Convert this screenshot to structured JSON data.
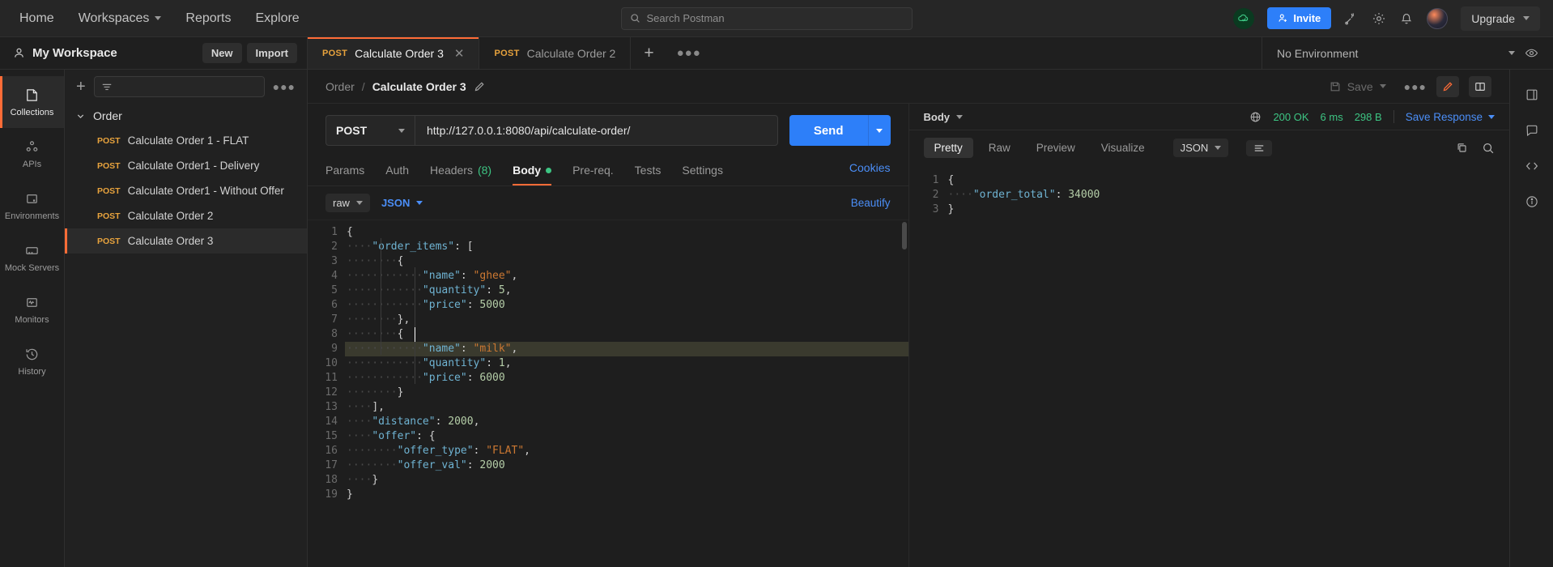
{
  "topbar": {
    "nav": [
      {
        "label": "Home",
        "icon": "none"
      },
      {
        "label": "Workspaces",
        "icon": "chevron-down-icon"
      },
      {
        "label": "Reports",
        "icon": "none"
      },
      {
        "label": "Explore",
        "icon": "none"
      }
    ],
    "search_placeholder": "Search Postman",
    "invite_label": "Invite",
    "upgrade_label": "Upgrade",
    "icons": [
      "cloud-check-icon",
      "satellite-icon",
      "gear-icon",
      "bell-icon",
      "avatar"
    ]
  },
  "workspace": {
    "name": "My Workspace",
    "new_label": "New",
    "import_label": "Import",
    "environment_selected": "No Environment",
    "tabs": [
      {
        "method": "POST",
        "title": "Calculate Order 3",
        "active": true,
        "closable": true
      },
      {
        "method": "POST",
        "title": "Calculate Order 2",
        "active": false,
        "closable": false
      }
    ]
  },
  "rail": [
    {
      "label": "Collections",
      "icon": "collections-icon",
      "active": true
    },
    {
      "label": "APIs",
      "icon": "apis-icon",
      "active": false
    },
    {
      "label": "Environments",
      "icon": "environments-icon",
      "active": false
    },
    {
      "label": "Mock Servers",
      "icon": "mock-servers-icon",
      "active": false
    },
    {
      "label": "Monitors",
      "icon": "monitors-icon",
      "active": false
    },
    {
      "label": "History",
      "icon": "history-icon",
      "active": false
    }
  ],
  "sidebar": {
    "collection": "Order",
    "requests": [
      {
        "method": "POST",
        "name": "Calculate Order 1 - FLAT",
        "selected": false
      },
      {
        "method": "POST",
        "name": "Calculate Order1 - Delivery",
        "selected": false
      },
      {
        "method": "POST",
        "name": "Calculate Order1 - Without Offer",
        "selected": false
      },
      {
        "method": "POST",
        "name": "Calculate Order 2",
        "selected": false
      },
      {
        "method": "POST",
        "name": "Calculate Order 3",
        "selected": true
      }
    ]
  },
  "request": {
    "breadcrumb_root": "Order",
    "breadcrumb_current": "Calculate Order 3",
    "save_label": "Save",
    "method": "POST",
    "url": "http://127.0.0.1:8080/api/calculate-order/",
    "send_label": "Send",
    "tabs": [
      {
        "label": "Params",
        "active": false
      },
      {
        "label": "Auth",
        "active": false
      },
      {
        "label": "Headers",
        "count": "(8)",
        "active": false
      },
      {
        "label": "Body",
        "dot": true,
        "active": true
      },
      {
        "label": "Pre-req.",
        "active": false
      },
      {
        "label": "Tests",
        "active": false
      },
      {
        "label": "Settings",
        "active": false
      }
    ],
    "cookies_label": "Cookies",
    "body_mode": "raw",
    "body_format": "JSON",
    "beautify_label": "Beautify",
    "body_lines": [
      {
        "n": 1,
        "indent": 0,
        "tokens": [
          [
            "punc",
            "{"
          ]
        ]
      },
      {
        "n": 2,
        "indent": 1,
        "tokens": [
          [
            "key",
            "\"order_items\""
          ],
          [
            "punc",
            ": ["
          ]
        ]
      },
      {
        "n": 3,
        "indent": 2,
        "tokens": [
          [
            "punc",
            "{"
          ]
        ]
      },
      {
        "n": 4,
        "indent": 3,
        "tokens": [
          [
            "key",
            "\"name\""
          ],
          [
            "punc",
            ": "
          ],
          [
            "str",
            "\"ghee\""
          ],
          [
            "punc",
            ","
          ]
        ]
      },
      {
        "n": 5,
        "indent": 3,
        "tokens": [
          [
            "key",
            "\"quantity\""
          ],
          [
            "punc",
            ": "
          ],
          [
            "num",
            "5"
          ],
          [
            "punc",
            ","
          ]
        ]
      },
      {
        "n": 6,
        "indent": 3,
        "tokens": [
          [
            "key",
            "\"price\""
          ],
          [
            "punc",
            ": "
          ],
          [
            "num",
            "5000"
          ]
        ]
      },
      {
        "n": 7,
        "indent": 2,
        "tokens": [
          [
            "punc",
            "},"
          ]
        ]
      },
      {
        "n": 8,
        "indent": 2,
        "tokens": [
          [
            "punc",
            "{"
          ]
        ]
      },
      {
        "n": 9,
        "indent": 3,
        "highlight": true,
        "tokens": [
          [
            "key",
            "\"name\""
          ],
          [
            "punc",
            ": "
          ],
          [
            "str",
            "\"milk\""
          ],
          [
            "punc",
            ","
          ]
        ]
      },
      {
        "n": 10,
        "indent": 3,
        "tokens": [
          [
            "key",
            "\"quantity\""
          ],
          [
            "punc",
            ": "
          ],
          [
            "num",
            "1"
          ],
          [
            "punc",
            ","
          ]
        ]
      },
      {
        "n": 11,
        "indent": 3,
        "tokens": [
          [
            "key",
            "\"price\""
          ],
          [
            "punc",
            ": "
          ],
          [
            "num",
            "6000"
          ]
        ]
      },
      {
        "n": 12,
        "indent": 2,
        "tokens": [
          [
            "punc",
            "}"
          ]
        ]
      },
      {
        "n": 13,
        "indent": 1,
        "tokens": [
          [
            "punc",
            "],"
          ]
        ]
      },
      {
        "n": 14,
        "indent": 1,
        "tokens": [
          [
            "key",
            "\"distance\""
          ],
          [
            "punc",
            ": "
          ],
          [
            "num",
            "2000"
          ],
          [
            "punc",
            ","
          ]
        ]
      },
      {
        "n": 15,
        "indent": 1,
        "tokens": [
          [
            "key",
            "\"offer\""
          ],
          [
            "punc",
            ": {"
          ]
        ]
      },
      {
        "n": 16,
        "indent": 2,
        "tokens": [
          [
            "key",
            "\"offer_type\""
          ],
          [
            "punc",
            ": "
          ],
          [
            "str",
            "\"FLAT\""
          ],
          [
            "punc",
            ","
          ]
        ]
      },
      {
        "n": 17,
        "indent": 2,
        "tokens": [
          [
            "key",
            "\"offer_val\""
          ],
          [
            "punc",
            ": "
          ],
          [
            "num",
            "2000"
          ]
        ]
      },
      {
        "n": 18,
        "indent": 1,
        "tokens": [
          [
            "punc",
            "}"
          ]
        ]
      },
      {
        "n": 19,
        "indent": 0,
        "tokens": [
          [
            "punc",
            "}"
          ]
        ]
      }
    ]
  },
  "response": {
    "section_label": "Body",
    "status_code": "200 OK",
    "time": "6 ms",
    "size": "298 B",
    "save_response_label": "Save Response",
    "view_tabs": [
      {
        "label": "Pretty",
        "active": true
      },
      {
        "label": "Raw",
        "active": false
      },
      {
        "label": "Preview",
        "active": false
      },
      {
        "label": "Visualize",
        "active": false
      }
    ],
    "format": "JSON",
    "icons": [
      "copy-icon",
      "search-icon",
      "globe-icon",
      "wrap-lines-icon"
    ],
    "body_lines": [
      {
        "n": 1,
        "indent": 0,
        "tokens": [
          [
            "punc",
            "{"
          ]
        ]
      },
      {
        "n": 2,
        "indent": 1,
        "tokens": [
          [
            "key",
            "\"order_total\""
          ],
          [
            "punc",
            ": "
          ],
          [
            "num",
            "34000"
          ]
        ]
      },
      {
        "n": 3,
        "indent": 0,
        "tokens": [
          [
            "punc",
            "}"
          ]
        ]
      }
    ]
  },
  "right_rail": [
    "panel-icon",
    "comment-icon",
    "code-icon",
    "info-icon"
  ],
  "colors": {
    "accent_orange": "#ff6c37",
    "accent_blue": "#2d7ff9",
    "link_blue": "#4b8ef7",
    "success_green": "#3dc583",
    "method_post": "#e8a33d"
  }
}
